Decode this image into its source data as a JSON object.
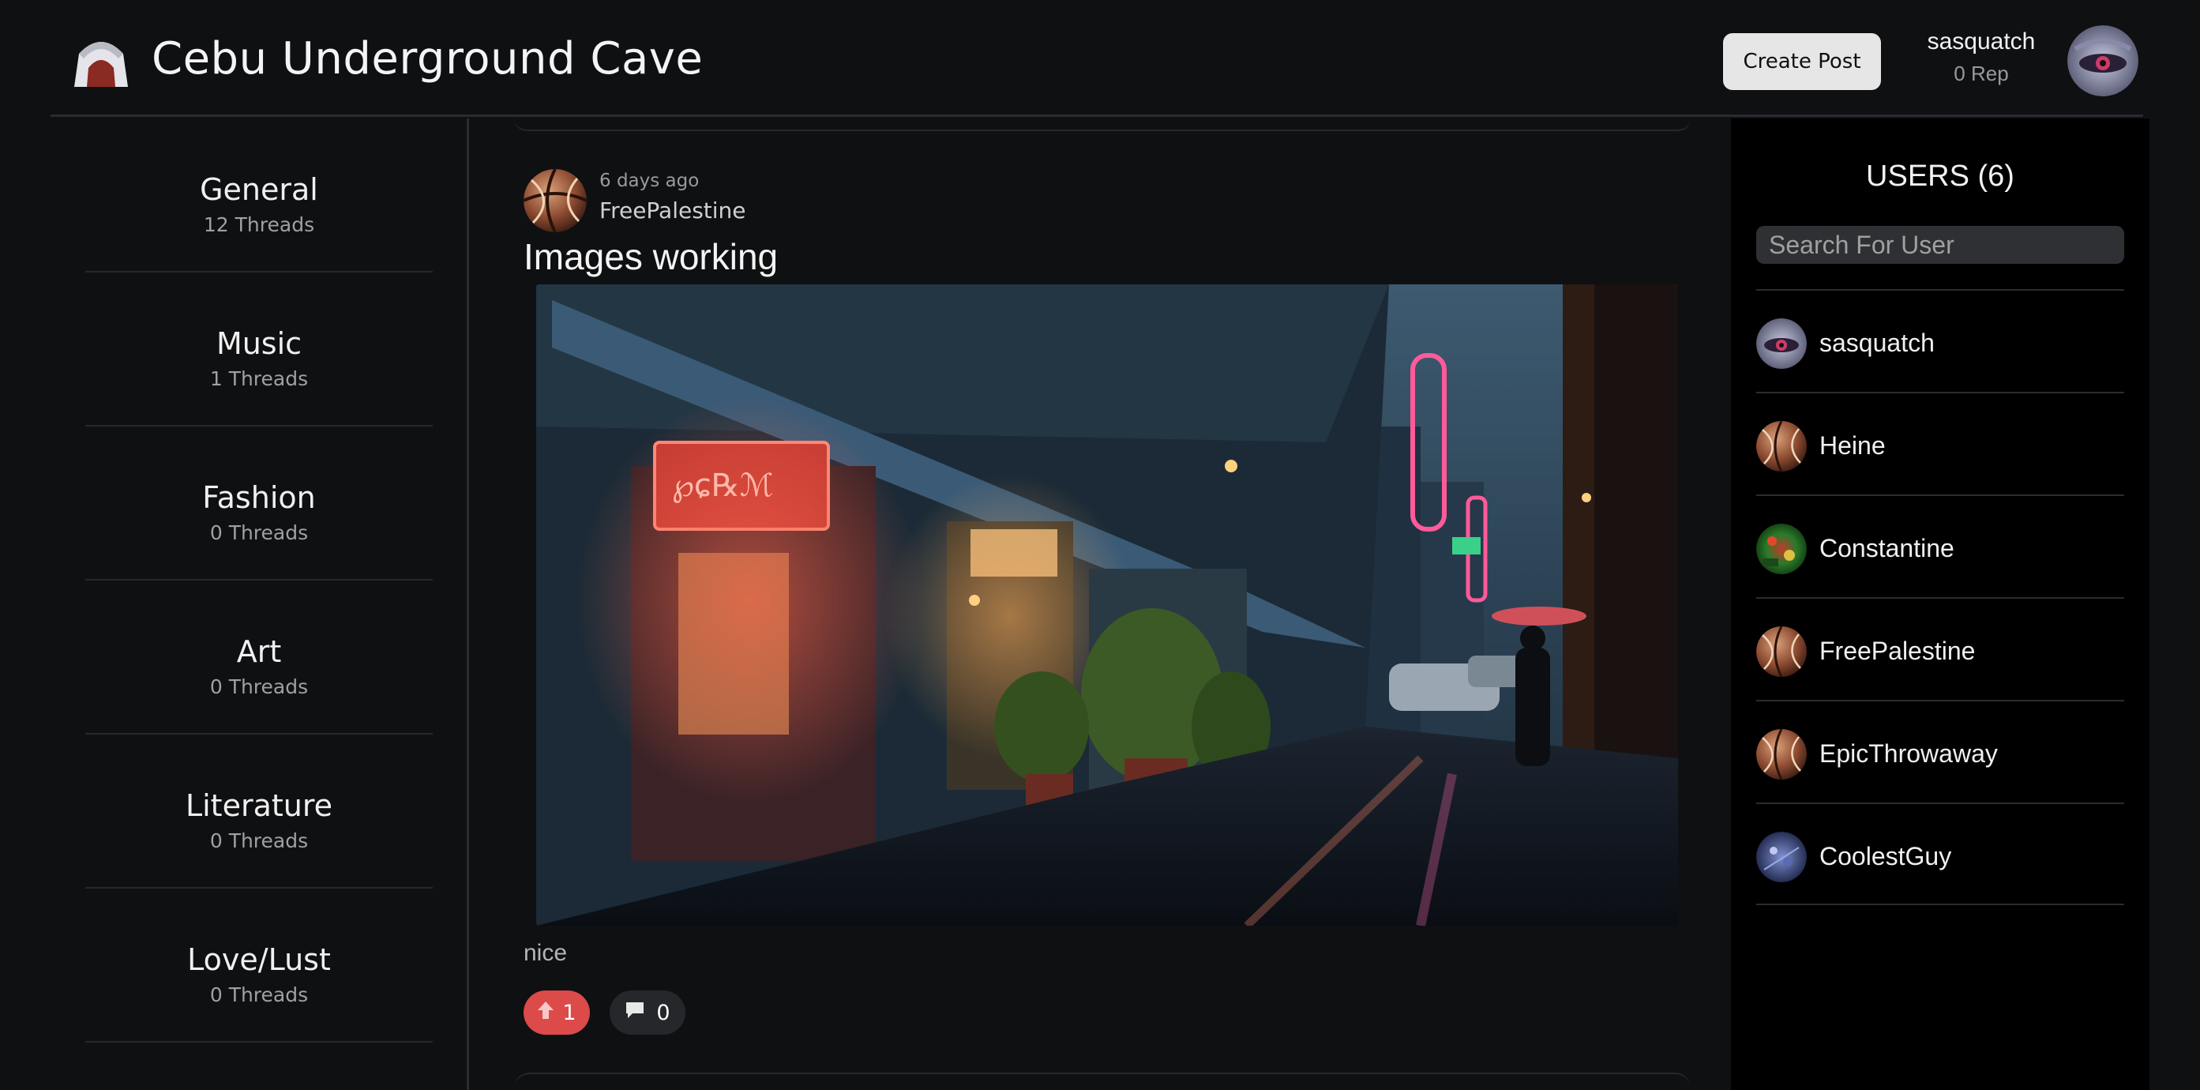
{
  "header": {
    "site_title": "Cebu Underground Cave",
    "create_post_label": "Create Post",
    "username": "sasquatch",
    "reputation": "0 Rep"
  },
  "categories": [
    {
      "name": "General",
      "count": "12 Threads"
    },
    {
      "name": "Music",
      "count": "1 Threads"
    },
    {
      "name": "Fashion",
      "count": "0 Threads"
    },
    {
      "name": "Art",
      "count": "0 Threads"
    },
    {
      "name": "Literature",
      "count": "0 Threads"
    },
    {
      "name": "Love/Lust",
      "count": "0 Threads"
    }
  ],
  "post": {
    "time_ago": "6 days ago",
    "author": "FreePalestine",
    "title": "Images working",
    "body": "nice",
    "upvotes": "1",
    "comments": "0"
  },
  "users_panel": {
    "title": "USERS (6)",
    "search_placeholder": "Search For User",
    "users": [
      {
        "name": "sasquatch",
        "avatar": "eye-avatar"
      },
      {
        "name": "Heine",
        "avatar": "basketball-avatar"
      },
      {
        "name": "Constantine",
        "avatar": "green-avatar"
      },
      {
        "name": "FreePalestine",
        "avatar": "basketball-avatar"
      },
      {
        "name": "EpicThrowaway",
        "avatar": "basketball-avatar"
      },
      {
        "name": "CoolestGuy",
        "avatar": "blue-avatar"
      }
    ]
  },
  "colors": {
    "background": "#0f1012",
    "upvote": "#dc4a4a",
    "sidebar_right": "#000000"
  }
}
